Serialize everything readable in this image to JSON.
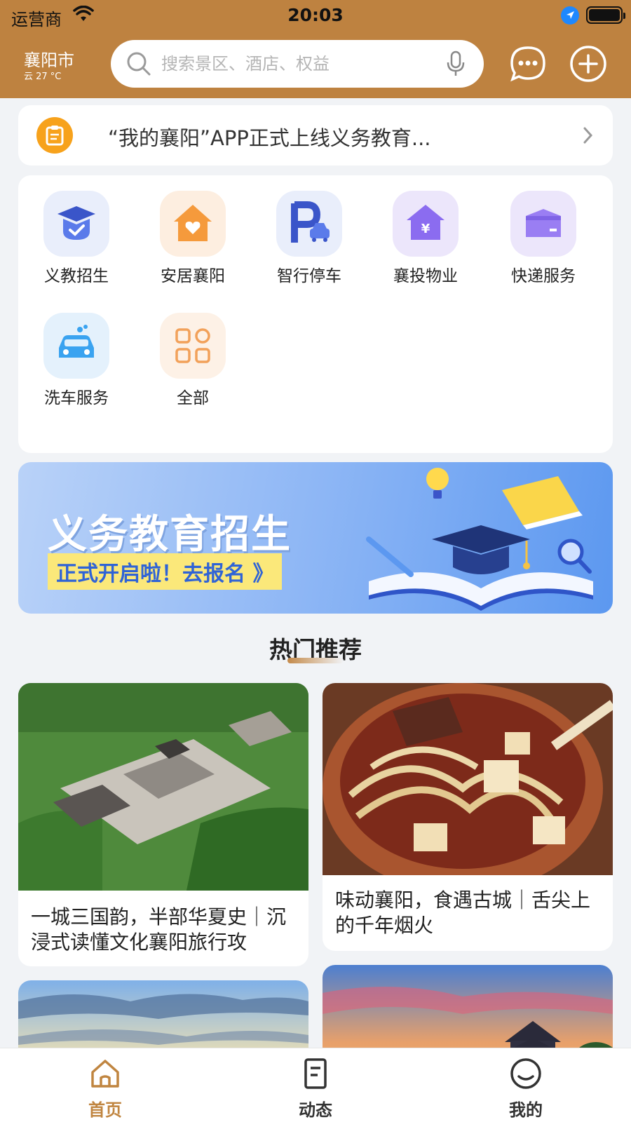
{
  "status": {
    "carrier": "运营商",
    "time": "20:03"
  },
  "header": {
    "city": "襄阳市",
    "weather": "云 27 °C",
    "search_placeholder": "搜索景区、酒店、权益"
  },
  "notice": {
    "text": "“我的襄阳”APP正式上线义务教育..."
  },
  "services": [
    {
      "label": "义教招生",
      "icon": "graduation-cap-icon"
    },
    {
      "label": "安居襄阳",
      "icon": "house-heart-icon"
    },
    {
      "label": "智行停车",
      "icon": "parking-icon"
    },
    {
      "label": "襄投物业",
      "icon": "property-house-icon"
    },
    {
      "label": "快递服务",
      "icon": "package-icon"
    },
    {
      "label": "洗车服务",
      "icon": "car-wash-icon"
    },
    {
      "label": "全部",
      "icon": "grid-all-icon"
    }
  ],
  "banner": {
    "title": "义务教育招生",
    "subtitle": "正式开启啦！去报名 》"
  },
  "section": {
    "title": "热门推荐"
  },
  "cards": [
    {
      "title": "一城三国韵，半部华夏史｜沉浸式读懂文化襄阳旅行攻"
    },
    {
      "title": "味动襄阳，食遇古城｜舌尖上的千年烟火"
    }
  ],
  "tabs": [
    {
      "label": "首页",
      "active": true
    },
    {
      "label": "动态",
      "active": false
    },
    {
      "label": "我的",
      "active": false
    }
  ],
  "colors": {
    "header": "#be8240",
    "active_tab": "#c08540",
    "accent_orange": "#f7a21c"
  }
}
